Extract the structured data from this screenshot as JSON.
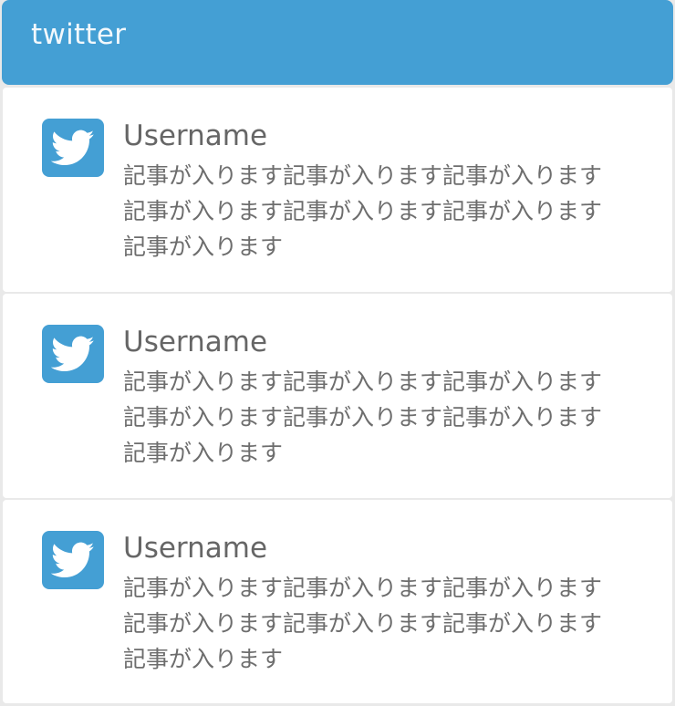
{
  "header": {
    "title": "twitter"
  },
  "tweets": [
    {
      "username": "Username",
      "lines": [
        "記事が入ります記事が入ります記事が入ります",
        "記事が入ります記事が入ります記事が入ります",
        "記事が入ります"
      ]
    },
    {
      "username": "Username",
      "lines": [
        "記事が入ります記事が入ります記事が入ります",
        "記事が入ります記事が入ります記事が入ります",
        "記事が入ります"
      ]
    },
    {
      "username": "Username",
      "lines": [
        "記事が入ります記事が入ります記事が入ります",
        "記事が入ります記事が入ります記事が入ります",
        "記事が入ります"
      ]
    }
  ],
  "icons": {
    "avatar": "twitter-bird-icon"
  },
  "colors": {
    "accent": "#449fd4",
    "background": "#e9e9e9",
    "card": "#ffffff",
    "text": "#666666"
  }
}
